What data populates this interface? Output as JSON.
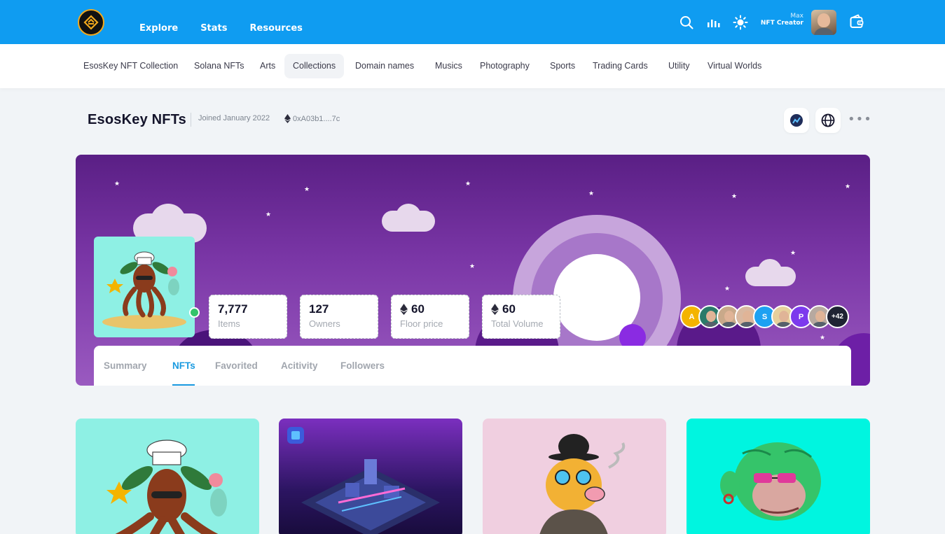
{
  "header": {
    "nav": [
      "Explore",
      "Stats",
      "Resources"
    ],
    "user": {
      "name": "Max",
      "role": "NFT Creator"
    }
  },
  "categories": [
    "EsosKey NFT Collection",
    "Solana NFTs",
    "Arts",
    "Collections",
    "Domain names",
    "Musics",
    "Photography",
    "Sports",
    "Trading Cards",
    "Utility",
    "Virtual Worlds"
  ],
  "active_category": "Collections",
  "collection": {
    "title": "EsosKey NFTs",
    "joined": "Joined January 2022",
    "address": "0xA03b1....7c"
  },
  "stats": [
    {
      "value": "7,777",
      "label": "Items",
      "eth": false
    },
    {
      "value": "127",
      "label": "Owners",
      "eth": false
    },
    {
      "value": "60",
      "label": "Floor price",
      "eth": true
    },
    {
      "value": "60",
      "label": "Total Volume",
      "eth": true
    }
  ],
  "owners": {
    "initials": [
      "A",
      "S",
      "P"
    ],
    "more": "+42",
    "colors": {
      "A": "#f4b400",
      "S": "#1da1f2",
      "P": "#7c3aed",
      "more": "#1f2333"
    }
  },
  "tabs": [
    "Summary",
    "NFTs",
    "Favorited",
    "Acitivity",
    "Followers"
  ],
  "active_tab": "NFTs",
  "colors": {
    "topbar": "#0f9cf1",
    "accent": "#1a9ae0",
    "banner_top": "#5a1f85",
    "banner_bottom": "#9a5ac0"
  }
}
